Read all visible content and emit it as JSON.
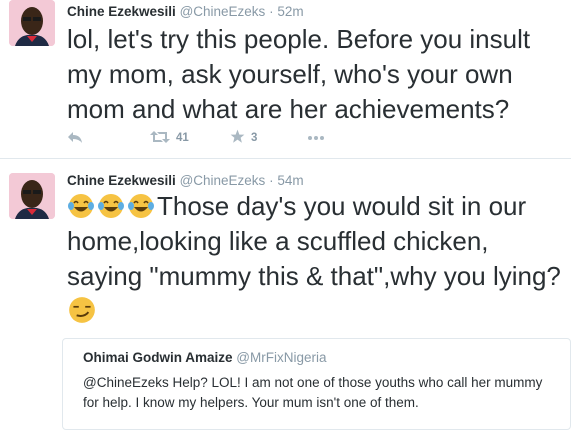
{
  "tweets": [
    {
      "author_name": "Chine Ezekwesili",
      "author_handle": "@ChineEzeks",
      "time": "· 52m",
      "text": "lol, let's try this people. Before you insult my mom, ask yourself, who's your own mom and what are her achievements?",
      "actions": {
        "reply_icon": "reply-icon",
        "retweet_icon": "retweet-icon",
        "retweet_count": "41",
        "favorite_icon": "star-icon",
        "favorite_count": "3",
        "more_icon": "more-dots-icon"
      }
    },
    {
      "author_name": "Chine Ezekwesili",
      "author_handle": "@ChineEzeks",
      "time": "· 54m",
      "text": "Those day's you would sit in our home,looking like a scuffled chicken, saying \"mummy this & that\",why you lying?",
      "leading_emoji": [
        "tears-of-joy-emoji",
        "tears-of-joy-emoji",
        "tears-of-joy-emoji"
      ],
      "trailing_emoji": "smirking-face-emoji",
      "quote": {
        "author_name": "Ohimai Godwin Amaize",
        "author_handle": "@MrFixNigeria",
        "text": "@ChineEzeks Help? LOL! I am not one of those youths who call her mummy for help. I know my helpers. Your mum isn't one of them."
      }
    }
  ],
  "colors": {
    "text": "#292f33",
    "muted": "#8899a6",
    "icon": "#aab8c2",
    "border": "#e1e8ed",
    "avatar_bg": "#f3c9d6"
  }
}
